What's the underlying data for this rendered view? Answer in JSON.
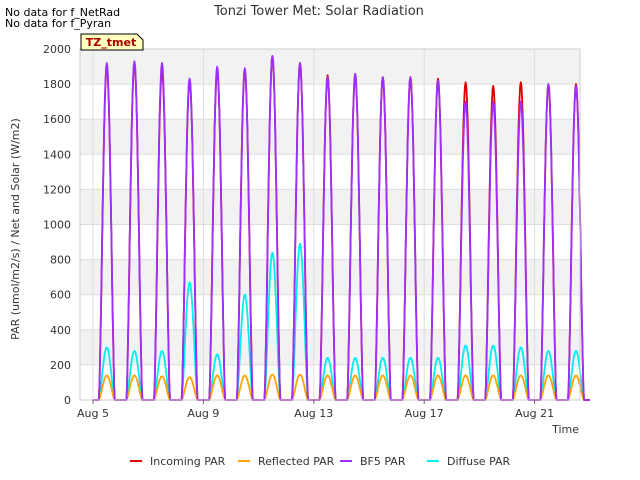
{
  "notes": [
    "No data for f_NetRad",
    "No data for f_Pyran"
  ],
  "chart_data": {
    "type": "line",
    "title": "Tonzi Tower Met: Solar Radiation",
    "xlabel": "Time",
    "ylabel": "PAR (umol/m2/s) / Net and Solar (W/m2)",
    "badge": "TZ_tmet",
    "xlim": [
      "2024-08-05",
      "2024-08-23"
    ],
    "ylim": [
      0,
      2000
    ],
    "x_ticks": [
      "Aug 5",
      "Aug 9",
      "Aug 13",
      "Aug 17",
      "Aug 21"
    ],
    "y_ticks": [
      0,
      200,
      400,
      600,
      800,
      1000,
      1200,
      1400,
      1600,
      1800,
      2000
    ],
    "grid": true,
    "legend_position": "bottom",
    "days": [
      "Aug 5",
      "Aug 6",
      "Aug 7",
      "Aug 8",
      "Aug 9",
      "Aug 10",
      "Aug 11",
      "Aug 12",
      "Aug 13",
      "Aug 14",
      "Aug 15",
      "Aug 16",
      "Aug 17",
      "Aug 18",
      "Aug 19",
      "Aug 20",
      "Aug 21",
      "Aug 22"
    ],
    "series": [
      {
        "name": "Incoming PAR",
        "color": "#dd0000",
        "daily_peak": [
          1900,
          1920,
          1880,
          1830,
          1880,
          1880,
          1960,
          1920,
          1850,
          1850,
          1840,
          1840,
          1830,
          1810,
          1790,
          1810,
          1800,
          1800
        ]
      },
      {
        "name": "Reflected PAR",
        "color": "#ffa500",
        "daily_peak": [
          140,
          140,
          135,
          130,
          140,
          140,
          145,
          145,
          140,
          140,
          140,
          140,
          140,
          140,
          140,
          140,
          140,
          140
        ]
      },
      {
        "name": "BF5 PAR",
        "color": "#9b30ff",
        "daily_peak": [
          1920,
          1930,
          1920,
          1830,
          1900,
          1890,
          1960,
          1920,
          1840,
          1860,
          1840,
          1840,
          1820,
          1700,
          1700,
          1700,
          1800,
          1790
        ]
      },
      {
        "name": "Diffuse PAR",
        "color": "#00eeee",
        "daily_peak": [
          300,
          280,
          280,
          670,
          260,
          600,
          840,
          890,
          240,
          240,
          240,
          240,
          240,
          310,
          310,
          300,
          280,
          280
        ]
      }
    ]
  }
}
